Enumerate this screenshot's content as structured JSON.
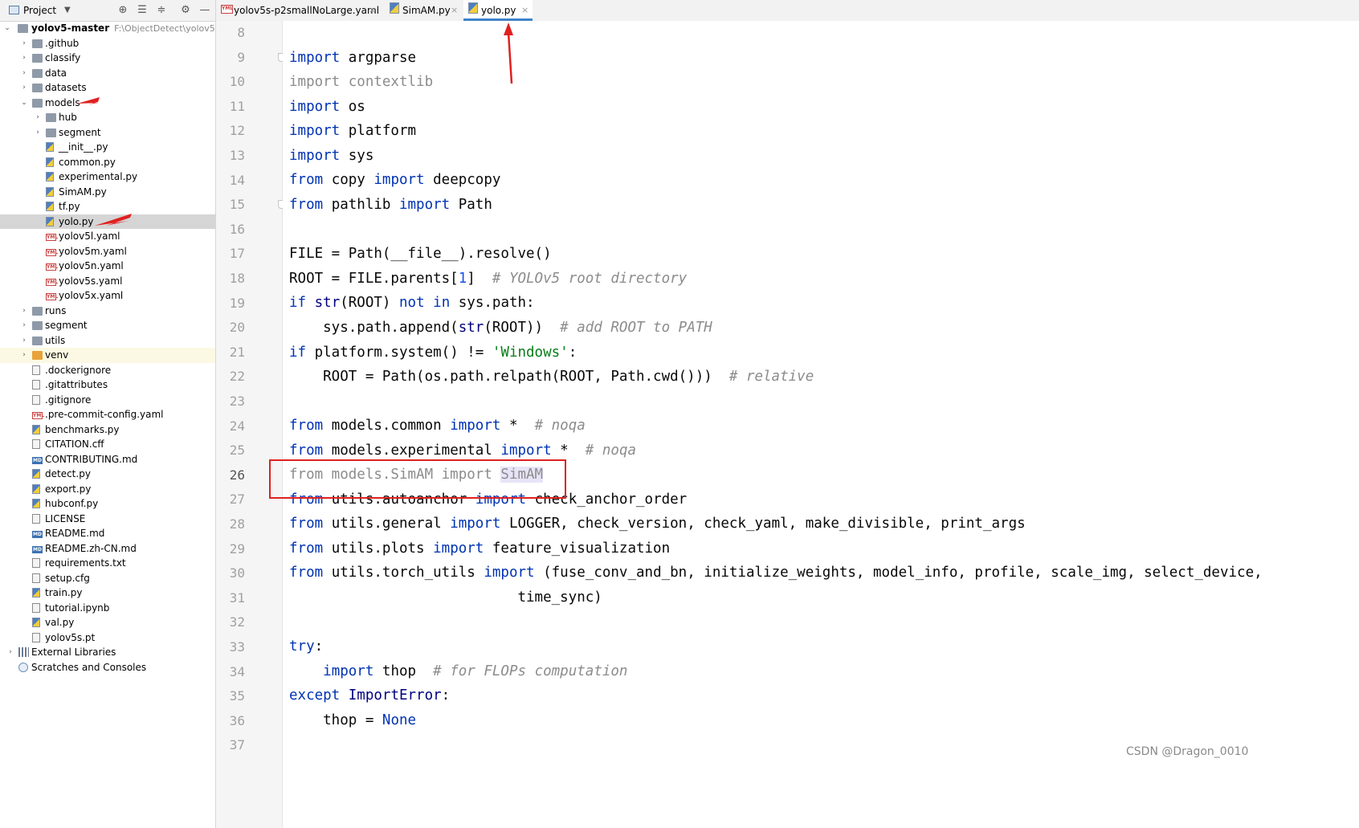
{
  "project_panel": {
    "title": "Project",
    "toolbar_icons": [
      "locate-icon",
      "expand-all-icon",
      "collapse-all-icon",
      "gear-icon",
      "minimize-icon"
    ],
    "root": {
      "name": "yolov5-master",
      "path": "F:\\ObjectDetect\\yolov5\\yol"
    },
    "items": [
      {
        "label": ".github",
        "kind": "folder",
        "level": 1,
        "arrow": "›"
      },
      {
        "label": "classify",
        "kind": "folder",
        "level": 1,
        "arrow": "›"
      },
      {
        "label": "data",
        "kind": "folder",
        "level": 1,
        "arrow": "›"
      },
      {
        "label": "datasets",
        "kind": "folder",
        "level": 1,
        "arrow": "›"
      },
      {
        "label": "models",
        "kind": "folder",
        "level": 1,
        "arrow": "⌄"
      },
      {
        "label": "hub",
        "kind": "folder",
        "level": 2,
        "arrow": "›"
      },
      {
        "label": "segment",
        "kind": "folder",
        "level": 2,
        "arrow": "›"
      },
      {
        "label": "__init__.py",
        "kind": "py",
        "level": 2
      },
      {
        "label": "common.py",
        "kind": "py",
        "level": 2
      },
      {
        "label": "experimental.py",
        "kind": "py",
        "level": 2
      },
      {
        "label": "SimAM.py",
        "kind": "py",
        "level": 2
      },
      {
        "label": "tf.py",
        "kind": "py",
        "level": 2
      },
      {
        "label": "yolo.py",
        "kind": "py",
        "level": 2,
        "selected": true
      },
      {
        "label": "yolov5l.yaml",
        "kind": "yaml",
        "level": 2
      },
      {
        "label": "yolov5m.yaml",
        "kind": "yaml",
        "level": 2
      },
      {
        "label": "yolov5n.yaml",
        "kind": "yaml",
        "level": 2
      },
      {
        "label": "yolov5s.yaml",
        "kind": "yaml",
        "level": 2
      },
      {
        "label": "yolov5x.yaml",
        "kind": "yaml",
        "level": 2
      },
      {
        "label": "runs",
        "kind": "folder",
        "level": 1,
        "arrow": "›"
      },
      {
        "label": "segment",
        "kind": "folder",
        "level": 1,
        "arrow": "›"
      },
      {
        "label": "utils",
        "kind": "folder",
        "level": 1,
        "arrow": "›"
      },
      {
        "label": "venv",
        "kind": "folder-orange",
        "level": 1,
        "arrow": "›",
        "venv": true
      },
      {
        "label": ".dockerignore",
        "kind": "txt",
        "level": 1
      },
      {
        "label": ".gitattributes",
        "kind": "txt",
        "level": 1
      },
      {
        "label": ".gitignore",
        "kind": "txt",
        "level": 1
      },
      {
        "label": ".pre-commit-config.yaml",
        "kind": "yaml",
        "level": 1
      },
      {
        "label": "benchmarks.py",
        "kind": "py",
        "level": 1
      },
      {
        "label": "CITATION.cff",
        "kind": "txt",
        "level": 1
      },
      {
        "label": "CONTRIBUTING.md",
        "kind": "md",
        "level": 1
      },
      {
        "label": "detect.py",
        "kind": "py",
        "level": 1
      },
      {
        "label": "export.py",
        "kind": "py",
        "level": 1
      },
      {
        "label": "hubconf.py",
        "kind": "py",
        "level": 1
      },
      {
        "label": "LICENSE",
        "kind": "txt",
        "level": 1
      },
      {
        "label": "README.md",
        "kind": "md",
        "level": 1
      },
      {
        "label": "README.zh-CN.md",
        "kind": "md",
        "level": 1
      },
      {
        "label": "requirements.txt",
        "kind": "txt",
        "level": 1
      },
      {
        "label": "setup.cfg",
        "kind": "txt",
        "level": 1
      },
      {
        "label": "train.py",
        "kind": "py",
        "level": 1
      },
      {
        "label": "tutorial.ipynb",
        "kind": "txt",
        "level": 1
      },
      {
        "label": "val.py",
        "kind": "py",
        "level": 1
      },
      {
        "label": "yolov5s.pt",
        "kind": "txt",
        "level": 1
      },
      {
        "label": "External Libraries",
        "kind": "lib",
        "level": 0,
        "arrow": "›"
      },
      {
        "label": "Scratches and Consoles",
        "kind": "scratch",
        "level": 0
      }
    ]
  },
  "tabs": [
    {
      "label": "yolov5s-p2smallNoLarge.yaml",
      "icon": "yaml-file-icon",
      "active": false
    },
    {
      "label": "SimAM.py",
      "icon": "python-file-icon",
      "active": false
    },
    {
      "label": "yolo.py",
      "icon": "python-file-icon",
      "active": true
    }
  ],
  "tab_close_glyph": "×",
  "yaml_badge": "YML",
  "md_badge": "MD",
  "editor": {
    "line_numbers": [
      "8",
      "9",
      "10",
      "11",
      "12",
      "13",
      "14",
      "15",
      "16",
      "17",
      "18",
      "19",
      "20",
      "21",
      "22",
      "23",
      "24",
      "25",
      "26",
      "27",
      "28",
      "29",
      "30",
      "31",
      "32",
      "33",
      "34",
      "35",
      "36",
      "37"
    ],
    "current_line": "26",
    "code": {
      "l9_kw": "import",
      "l9_rest": " argparse",
      "l10_kw": "import",
      "l10_rest": " contextlib",
      "l11_kw": "import",
      "l11_rest": " os",
      "l12_kw": "import",
      "l12_rest": " platform",
      "l13_kw": "import",
      "l13_rest": " sys",
      "l14_kw1": "from",
      "l14_mid": " copy ",
      "l14_kw2": "import",
      "l14_rest": " deepcopy",
      "l15_kw1": "from",
      "l15_mid": " pathlib ",
      "l15_kw2": "import",
      "l15_rest": " Path",
      "l17": "FILE = Path(__file__).resolve()",
      "l18_a": "ROOT = FILE.parents[",
      "l18_n": "1",
      "l18_b": "]  ",
      "l18_c": "# YOLOv5 root directory",
      "l19_kw1": "if",
      "l19_sp": " ",
      "l19_bi": "str",
      "l19_mid": "(ROOT) ",
      "l19_kw2": "not",
      "l19_sp2": " ",
      "l19_kw3": "in",
      "l19_rest": " sys.path:",
      "l20_a": "    sys.path.append(",
      "l20_bi": "str",
      "l20_b": "(ROOT))  ",
      "l20_c": "# add ROOT to PATH",
      "l21_kw": "if",
      "l21_mid": " platform.system() != ",
      "l21_st": "'Windows'",
      "l21_rest": ":",
      "l22_a": "    ROOT = Path(os.path.relpath(ROOT, Path.cwd()))  ",
      "l22_c": "# relative",
      "l24_kw1": "from",
      "l24_mid": " models.common ",
      "l24_kw2": "import",
      "l24_rest": " *  ",
      "l24_c": "# noqa",
      "l25_kw1": "from",
      "l25_mid": " models.experimental ",
      "l25_kw2": "import",
      "l25_rest": " *  ",
      "l25_c": "# noqa",
      "l26_a": "from models.SimAM import ",
      "l26_b": "SimAM",
      "l27_kw1": "from",
      "l27_mid": " utils.autoanchor ",
      "l27_kw2": "import",
      "l27_rest": " check_anchor_order",
      "l28_kw1": "from",
      "l28_mid": " utils.general ",
      "l28_kw2": "import",
      "l28_rest": " LOGGER, check_version, check_yaml, make_divisible, print_args",
      "l29_kw1": "from",
      "l29_mid": " utils.plots ",
      "l29_kw2": "import",
      "l29_rest": " feature_visualization",
      "l30_kw1": "from",
      "l30_mid": " utils.torch_utils ",
      "l30_kw2": "import",
      "l30_rest": " (fuse_conv_and_bn, initialize_weights, model_info, profile, scale_img, select_device,",
      "l31": "                           time_sync)",
      "l33_kw": "try",
      "l33_rest": ":",
      "l34_a": "    ",
      "l34_kw": "import",
      "l34_b": " thop  ",
      "l34_c": "# for FLOPs computation",
      "l35_kw": "except",
      "l35_sp": " ",
      "l35_bi": "ImportError",
      "l35_rest": ":",
      "l36_a": "    thop = ",
      "l36_kw": "None"
    }
  },
  "watermark": "CSDN @Dragon_0010",
  "colors": {
    "keyword": "#0033b3",
    "comment": "#8c8c8c",
    "string": "#067d17",
    "number": "#1750eb",
    "annotation": "#e02020",
    "tab_underline": "#4083c9"
  }
}
